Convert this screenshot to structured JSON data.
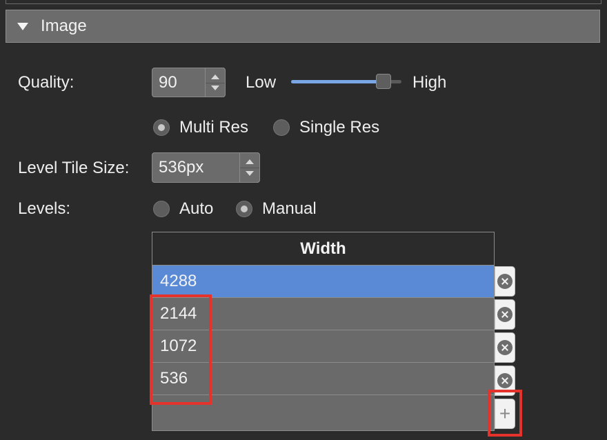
{
  "section": {
    "title": "Image"
  },
  "quality": {
    "label": "Quality:",
    "value": "90",
    "low_label": "Low",
    "high_label": "High",
    "slider_level": 0.84
  },
  "resolution": {
    "options": [
      "Multi Res",
      "Single Res"
    ],
    "selected": "Multi Res"
  },
  "tile_size": {
    "label": "Level Tile Size:",
    "value": "536px"
  },
  "levels": {
    "label": "Levels:",
    "options": [
      "Auto",
      "Manual"
    ],
    "selected": "Manual",
    "table": {
      "column": "Width",
      "rows": [
        "4288",
        "2144",
        "1072",
        "536"
      ],
      "selected_row": "4288"
    },
    "add_label": "+"
  },
  "colors": {
    "background": "#2b2b2b",
    "selection": "#5a8ad6",
    "slider_fill": "#7aa6e6",
    "highlight": "#e5322b"
  }
}
